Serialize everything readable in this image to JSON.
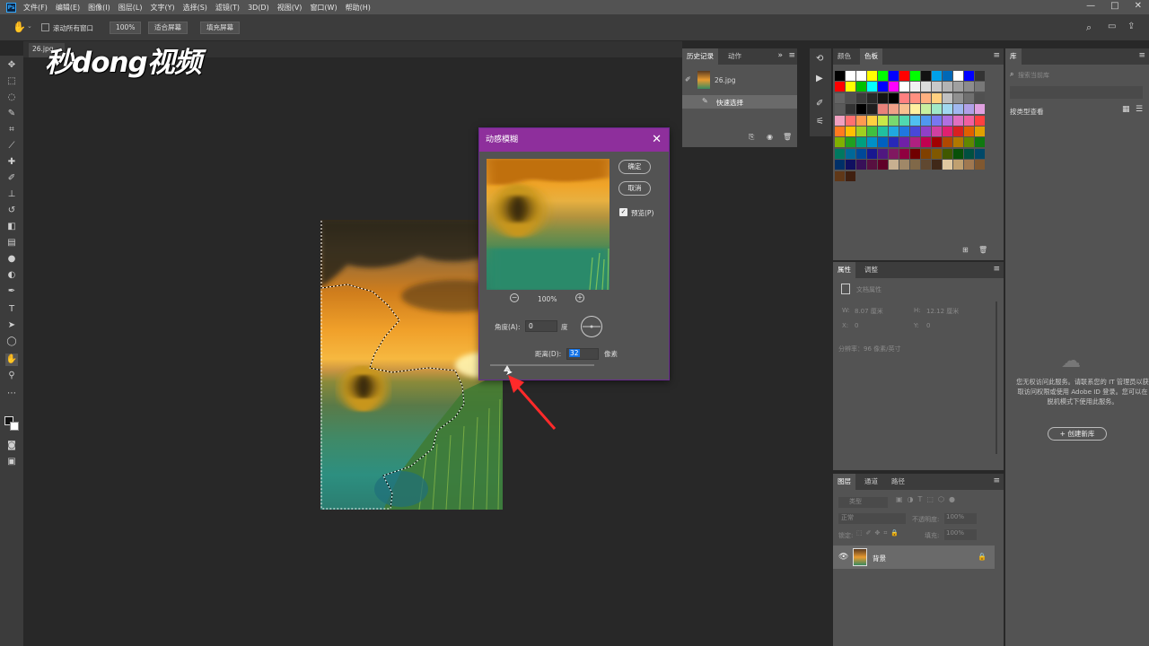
{
  "menubar": {
    "logo": "Ps",
    "items": [
      "文件(F)",
      "编辑(E)",
      "图像(I)",
      "图层(L)",
      "文字(Y)",
      "选择(S)",
      "滤镜(T)",
      "3D(D)",
      "视图(V)",
      "窗口(W)",
      "帮助(H)"
    ],
    "controls": {
      "minimize": "—",
      "maximize": "□",
      "close": "✕"
    }
  },
  "options": {
    "scroll_all": "滚动所有窗口",
    "zoom": "100%",
    "fit_screen": "适合屏幕",
    "fill_screen": "填充屏幕"
  },
  "document": {
    "tab": "26.jpg",
    "tab_close": "×"
  },
  "watermark": "秒dong视频",
  "history_panel": {
    "tabs": [
      "历史记录",
      "动作"
    ],
    "snapshot_name": "26.jpg",
    "state": "快速选择"
  },
  "swatch_panel": {
    "tabs": [
      "颜色",
      "色板"
    ],
    "colors": [
      "#000000",
      "#ffffff",
      "#ffffff",
      "#ffff00",
      "#00ff00",
      "#0000ff",
      "#ff0000",
      "#00ff00",
      "#111111",
      "#00a0e9",
      "#0068b7",
      "#ffffff",
      "#0000ff",
      "#333333",
      "#ff0000",
      "#ffff00",
      "#00c000",
      "#00ffff",
      "#0000ff",
      "#ff00ff",
      "#ffffff",
      "#f0f0f0",
      "#dcdcdc",
      "#c8c8c8",
      "#b4b4b4",
      "#a0a0a0",
      "#8c8c8c",
      "#787878",
      "#646464",
      "#505050",
      "#3c3c3c",
      "#282828",
      "#141414",
      "#000000",
      "#ff8080",
      "#ff9080",
      "#ffb080",
      "#ffd080",
      "#c0c0c0",
      "#909090",
      "#707070",
      "#505050",
      "#5a5a5a",
      "#323232",
      "#000000",
      "#1e1e1e",
      "#e8827a",
      "#f0a088",
      "#f8c090",
      "#fff0a0",
      "#c8f0a0",
      "#a0e8c8",
      "#a0d8f0",
      "#a0b8f0",
      "#b0a0e8",
      "#e0a0e0",
      "#f0a0c0",
      "#ff7070",
      "#ff9a50",
      "#ffd040",
      "#c8e848",
      "#78d870",
      "#50d8b0",
      "#50c0f0",
      "#5098f0",
      "#7878f0",
      "#b070e0",
      "#e070c0",
      "#f060a0",
      "#ff4040",
      "#ff7a20",
      "#ffc000",
      "#a0d020",
      "#40c040",
      "#20c0a0",
      "#20a8e0",
      "#2078e0",
      "#4848d8",
      "#9040c8",
      "#d040a0",
      "#e02070",
      "#d82020",
      "#e06000",
      "#e0a000",
      "#80b000",
      "#20a020",
      "#00a080",
      "#0090c8",
      "#0060c0",
      "#2828b8",
      "#7020a8",
      "#b02080",
      "#c00050",
      "#a00000",
      "#b04800",
      "#b07800",
      "#608800",
      "#107810",
      "#007860",
      "#006898",
      "#004898",
      "#181890",
      "#501880",
      "#801860",
      "#900040",
      "#700000",
      "#804000",
      "#805800",
      "#405800",
      "#085008",
      "#005040",
      "#004868",
      "#003068",
      "#101060",
      "#381058",
      "#581040",
      "#600028",
      "#c8b090",
      "#a08868",
      "#806848",
      "#604830",
      "#402818",
      "#e0c8a0",
      "#c0a070",
      "#a07850",
      "#805830",
      "#603818",
      "#402010"
    ]
  },
  "props_panel": {
    "tabs": [
      "属性",
      "调整"
    ],
    "doc_label": "文档属性",
    "w_label": "W:",
    "w_value": "8.07 厘米",
    "h_label": "H:",
    "h_value": "12.12 厘米",
    "x_label": "X:",
    "x_value": "0",
    "y_label": "Y:",
    "y_value": "0",
    "resolution": "分辨率：96 像素/英寸"
  },
  "layers_panel": {
    "tabs": [
      "图层",
      "通道",
      "路径"
    ],
    "kind": "类型",
    "blend": "正常",
    "opacity_label": "不透明度:",
    "opacity": "100%",
    "lock_label": "锁定:",
    "fill_label": "填充:",
    "fill": "100%",
    "layer_name": "背景"
  },
  "library_panel": {
    "title": "库",
    "search": "搜索当前库",
    "view_by": "按类型查看",
    "message": "您无权访问此服务。请联系您的 IT 管理员以获取访问权限或使用 Adobe ID 登录。您可以在脱机模式下使用此服务。",
    "create_button": "+ 创建新库"
  },
  "dialog": {
    "title": "动感模糊",
    "ok": "确定",
    "cancel": "取消",
    "preview_label": "预览(P)",
    "preview_checked": true,
    "zoom": "100%",
    "zoom_out_icon": "−",
    "zoom_in_icon": "+",
    "angle_label": "角度(A):",
    "angle_value": "0",
    "angle_unit": "度",
    "distance_label": "距离(D):",
    "distance_value": "32",
    "distance_unit": "像素",
    "slider_fraction": 0.16
  },
  "colors": {
    "dialog_title": "#8e2f9c",
    "arrow": "#ff2a2a",
    "accent": "#1473e6"
  }
}
